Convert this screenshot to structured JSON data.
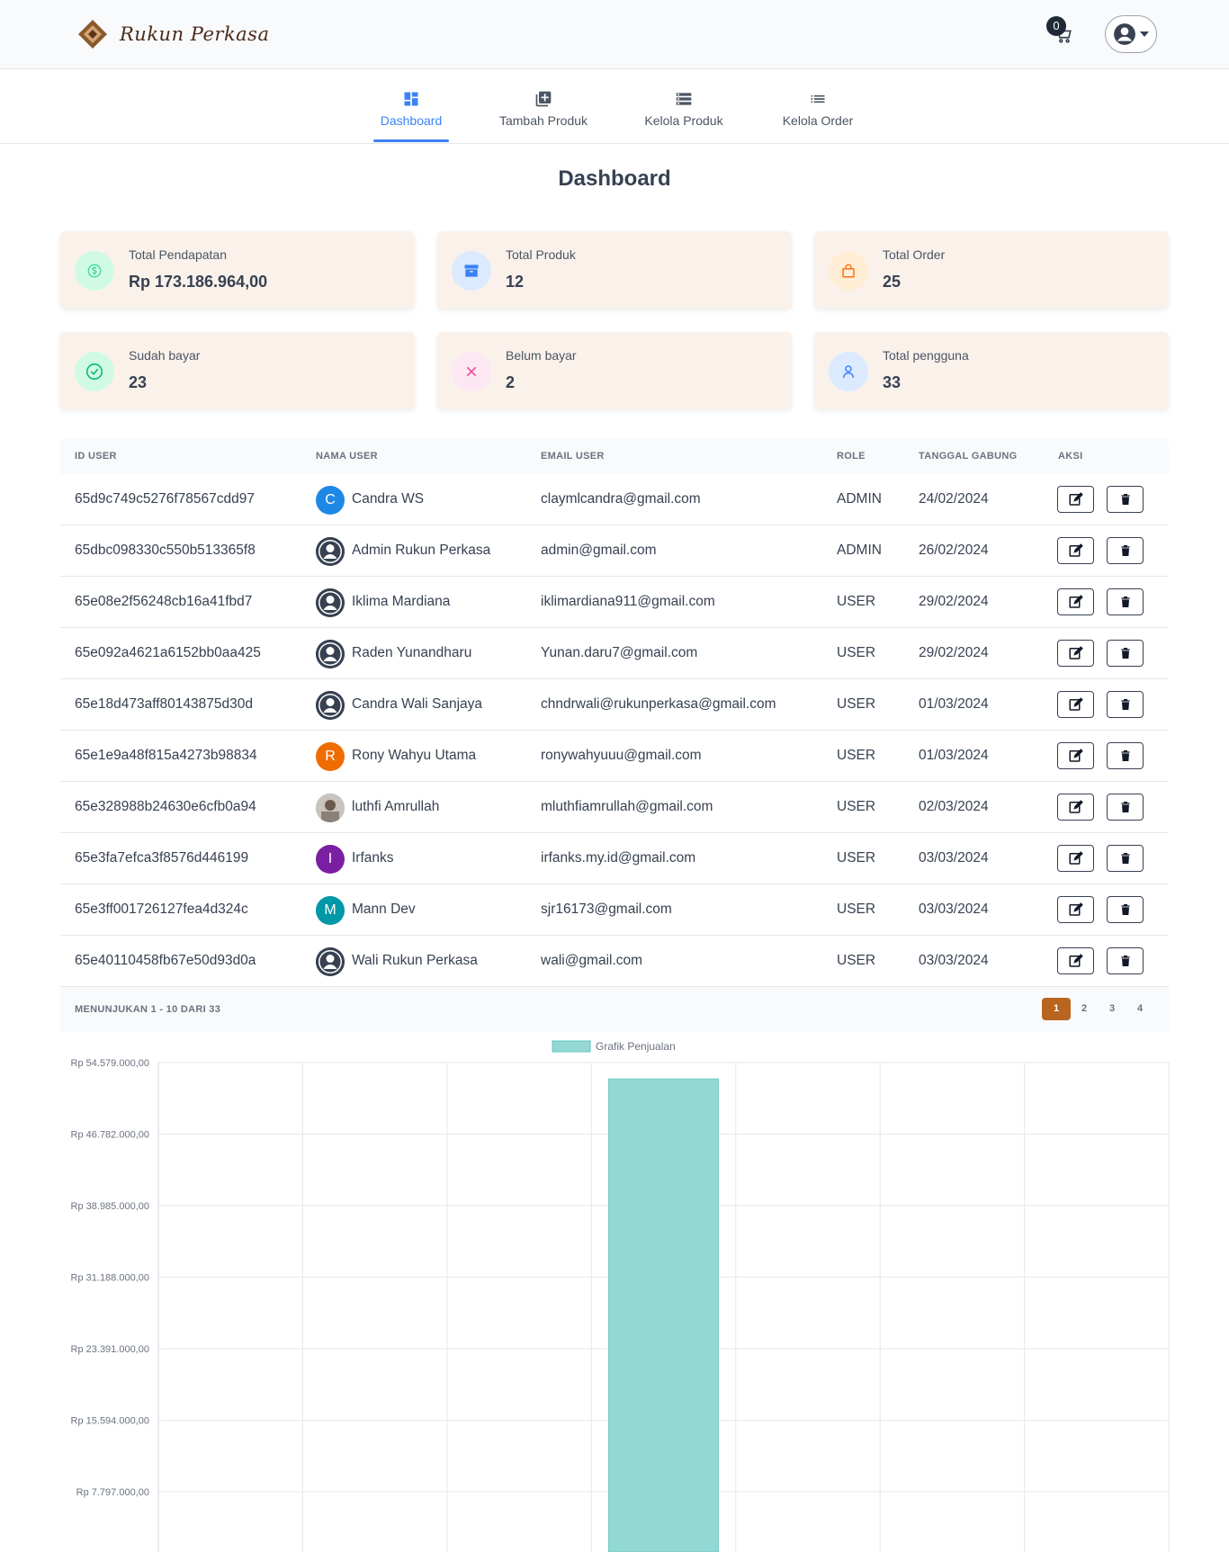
{
  "header": {
    "brand": "Rukun Perkasa",
    "cart_count": "0"
  },
  "nav": {
    "items": [
      {
        "label": "Dashboard",
        "icon": "dashboard-icon",
        "active": true
      },
      {
        "label": "Tambah Produk",
        "icon": "add-box-icon",
        "active": false
      },
      {
        "label": "Kelola Produk",
        "icon": "storage-icon",
        "active": false
      },
      {
        "label": "Kelola Order",
        "icon": "list-icon",
        "active": false
      }
    ]
  },
  "page_title": "Dashboard",
  "stats": [
    {
      "label": "Total Pendapatan",
      "value": "Rp 173.186.964,00",
      "icon": "dollar-icon",
      "color": "#34d399"
    },
    {
      "label": "Total Produk",
      "value": "12",
      "icon": "box-icon",
      "color": "#3b82f6"
    },
    {
      "label": "Total Order",
      "value": "25",
      "icon": "bag-icon",
      "color": "#f97316"
    },
    {
      "label": "Sudah bayar",
      "value": "23",
      "icon": "check-circle-icon",
      "color": "#10b981"
    },
    {
      "label": "Belum bayar",
      "value": "2",
      "icon": "x-icon",
      "color": "#ec4899"
    },
    {
      "label": "Total pengguna",
      "value": "33",
      "icon": "user-icon",
      "color": "#3b82f6"
    }
  ],
  "table": {
    "headers": [
      "ID USER",
      "NAMA USER",
      "EMAIL USER",
      "ROLE",
      "TANGGAL GABUNG",
      "AKSI"
    ],
    "rows": [
      {
        "id": "65d9c749c5276f78567cdd97",
        "name": "Candra WS",
        "avatar": "C",
        "avatar_color": "#1e88e5",
        "email": "claymlcandra@gmail.com",
        "role": "ADMIN",
        "date": "24/02/2024"
      },
      {
        "id": "65dbc098330c550b513365f8",
        "name": "Admin Rukun Perkasa",
        "avatar": "",
        "avatar_color": "#374151",
        "email": "admin@gmail.com",
        "role": "ADMIN",
        "date": "26/02/2024"
      },
      {
        "id": "65e08e2f56248cb16a41fbd7",
        "name": "Iklima Mardiana",
        "avatar": "",
        "avatar_color": "#374151",
        "email": "iklimardiana911@gmail.com",
        "role": "USER",
        "date": "29/02/2024"
      },
      {
        "id": "65e092a4621a6152bb0aa425",
        "name": "Raden Yunandharu",
        "avatar": "",
        "avatar_color": "#374151",
        "email": "Yunan.daru7@gmail.com",
        "role": "USER",
        "date": "29/02/2024"
      },
      {
        "id": "65e18d473aff80143875d30d",
        "name": "Candra Wali Sanjaya",
        "avatar": "",
        "avatar_color": "#374151",
        "email": "chndrwali@rukunperkasa@gmail.com",
        "role": "USER",
        "date": "01/03/2024"
      },
      {
        "id": "65e1e9a48f815a4273b98834",
        "name": "Rony Wahyu Utama",
        "avatar": "R",
        "avatar_color": "#ef6c00",
        "email": "ronywahyuuu@gmail.com",
        "role": "USER",
        "date": "01/03/2024"
      },
      {
        "id": "65e328988b24630e6cfb0a94",
        "name": "luthfi Amrullah",
        "avatar": "photo",
        "avatar_color": "#a1a1aa",
        "email": "mluthfiamrullah@gmail.com",
        "role": "USER",
        "date": "02/03/2024"
      },
      {
        "id": "65e3fa7efca3f8576d446199",
        "name": "Irfanks",
        "avatar": "I",
        "avatar_color": "#7b1fa2",
        "email": "irfanks.my.id@gmail.com",
        "role": "USER",
        "date": "03/03/2024"
      },
      {
        "id": "65e3ff001726127fea4d324c",
        "name": "Mann Dev",
        "avatar": "M",
        "avatar_color": "#0097a7",
        "email": "sjr16173@gmail.com",
        "role": "USER",
        "date": "03/03/2024"
      },
      {
        "id": "65e40110458fb67e50d93d0a",
        "name": "Wali Rukun Perkasa",
        "avatar": "",
        "avatar_color": "#374151",
        "email": "wali@gmail.com",
        "role": "USER",
        "date": "03/03/2024"
      }
    ],
    "footer_info": "MENUNJUKAN 1 - 10 DARI 33",
    "pages": [
      "1",
      "2",
      "3",
      "4"
    ],
    "current_page": "1"
  },
  "chart_data": {
    "type": "bar",
    "legend": [
      "Grafik Penjualan"
    ],
    "series": [
      {
        "name": "Grafik Penjualan",
        "color": "#94d8d6",
        "values": [
          0,
          0,
          0,
          52800000,
          0,
          0,
          0
        ]
      }
    ],
    "categories": [
      "",
      "",
      "",
      "",
      "",
      "",
      ""
    ],
    "y_ticks": [
      "Rp 54.579.000,00",
      "Rp 46.782.000,00",
      "Rp 38.985.000,00",
      "Rp 31.188.000,00",
      "Rp 23.391.000,00",
      "Rp 15.594.000,00",
      "Rp 7.797.000,00"
    ],
    "y_tick_values": [
      54579000,
      46782000,
      38985000,
      31188000,
      23391000,
      15594000,
      7797000
    ],
    "ylim": [
      0,
      54579000
    ],
    "grid": true,
    "legend_position": "top-center"
  }
}
